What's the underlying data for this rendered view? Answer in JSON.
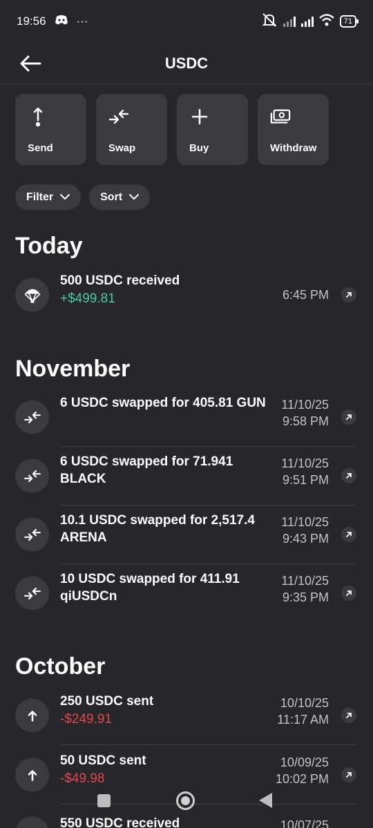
{
  "status": {
    "time": "19:56",
    "dots": "···",
    "battery": "71"
  },
  "header": {
    "title": "USDC"
  },
  "actions": [
    {
      "label": "Send"
    },
    {
      "label": "Swap"
    },
    {
      "label": "Buy"
    },
    {
      "label": "Withdraw"
    }
  ],
  "filters": {
    "filter_label": "Filter",
    "sort_label": "Sort"
  },
  "sections": {
    "today": "Today",
    "november": "November",
    "october": "October"
  },
  "transactions": [
    {
      "title": "500 USDC received",
      "amount": "+$499.81",
      "date": "",
      "time": "6:45 PM"
    },
    {
      "title": "6 USDC swapped for 405.81 GUN",
      "date": "11/10/25",
      "time": "9:58 PM"
    },
    {
      "title": "6 USDC swapped for 71.941 BLACK",
      "date": "11/10/25",
      "time": "9:51 PM"
    },
    {
      "title": "10.1 USDC swapped for 2,517.4 ARENA",
      "date": "11/10/25",
      "time": "9:43 PM"
    },
    {
      "title": "10 USDC swapped for 411.91 qiUSDCn",
      "date": "11/10/25",
      "time": "9:35 PM"
    },
    {
      "title": "250 USDC sent",
      "amount": "-$249.91",
      "date": "10/10/25",
      "time": "11:17 AM"
    },
    {
      "title": "50 USDC sent",
      "amount": "-$49.98",
      "date": "10/09/25",
      "time": "10:02 PM"
    },
    {
      "title": "550 USDC received",
      "date": "10/07/25"
    }
  ],
  "icons": {
    "back": "arrow-left-icon",
    "send": "arrow-up-icon",
    "swap": "swap-icon",
    "buy": "plus-icon",
    "withdraw": "cash-icon",
    "receive": "parachute-icon",
    "external": "external-link-icon"
  },
  "colors": {
    "background": "#27272b",
    "tile": "#3a3a3f",
    "positive": "#49c9a3",
    "negative": "#e0474c"
  }
}
